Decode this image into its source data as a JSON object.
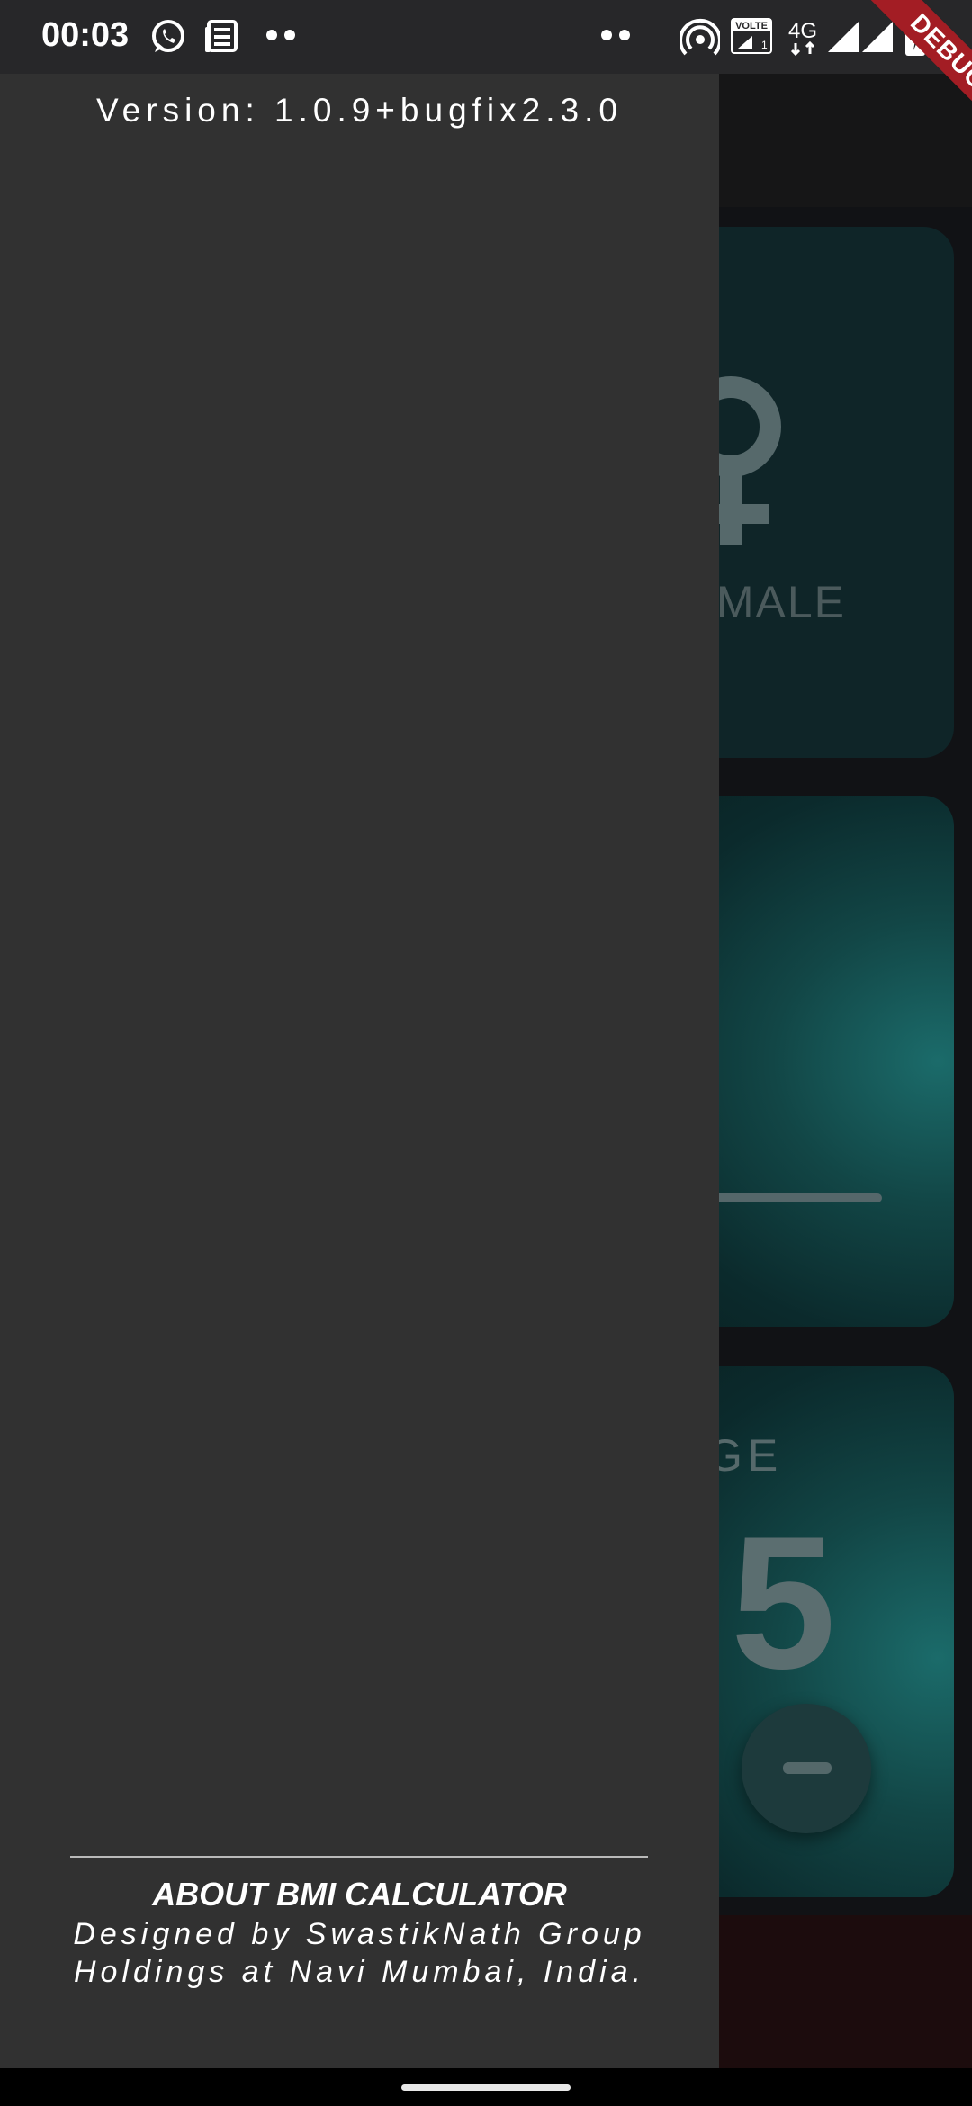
{
  "status_bar": {
    "time": "00:03",
    "icons": [
      "whatsapp-icon",
      "news-icon",
      "more-dots-icon",
      "more-dots-icon",
      "hotspot-icon",
      "volte-icon",
      "4g-icon",
      "signal-icon",
      "signal-icon",
      "battery-charging-icon"
    ],
    "volte_label": "VOLTE",
    "network_label": "4G"
  },
  "debug_banner": "DEBUG",
  "drawer": {
    "version": "Version: 1.0.9+bugfix2.3.0",
    "about_title": "ABOUT BMI CALCULATOR",
    "about_description": "Designed by SwastikNath Group Holdings at Navi Mumbai, India."
  },
  "background_app": {
    "gender_label": "MALE",
    "age_label": "GE",
    "age_value": "5"
  },
  "colors": {
    "drawer_bg": "#313131",
    "accent_teal": "#1b6b6a",
    "debug_red": "#a31d24"
  }
}
